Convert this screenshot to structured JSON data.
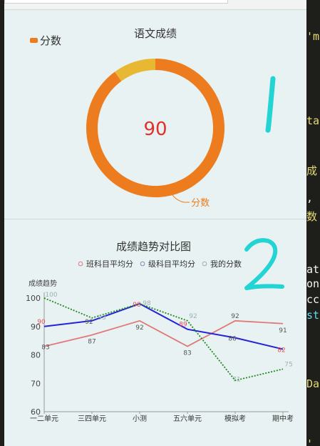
{
  "editor": {
    "fragments": [
      "'m",
      "ta",
      "成",
      ",",
      "数",
      "at",
      "on",
      "cc",
      "st",
      "Da",
      "'"
    ]
  },
  "donut": {
    "title": "语文成绩",
    "legend_label": "分数",
    "center_value": "90",
    "slice_label": "分数",
    "colors": {
      "score": "#ec7c1e",
      "remainder": "#e8b832",
      "center_text": "#e0312a"
    }
  },
  "trend": {
    "title": "成绩趋势对比图",
    "legend": [
      "班科目平均分",
      "级科目平均分",
      "我的分数"
    ],
    "ylabel": "成绩趋势"
  },
  "annotations": {
    "mark1": "1",
    "mark2": "2"
  },
  "chart_data": [
    {
      "type": "pie",
      "title": "语文成绩",
      "categories": [
        "分数",
        ""
      ],
      "values": [
        90,
        10
      ],
      "center_label": "90",
      "legend": [
        "分数"
      ],
      "legend_position": "top-left"
    },
    {
      "type": "line",
      "title": "成绩趋势对比图",
      "ylabel": "成绩趋势",
      "xlabel": "",
      "categories": [
        "一二单元",
        "三四单元",
        "小测",
        "五六单元",
        "模拟考",
        "期中考"
      ],
      "ylim": [
        60,
        100
      ],
      "yticks": [
        60,
        70,
        80,
        90,
        100
      ],
      "grid": false,
      "legend_position": "top",
      "series": [
        {
          "name": "班科目平均分",
          "values": [
            83,
            87,
            92,
            83,
            92,
            91
          ],
          "color": "#e07a78",
          "style": "solid"
        },
        {
          "name": "级科目平均分",
          "values": [
            90,
            92,
            98,
            89,
            86,
            82
          ],
          "color": "#2323d8",
          "style": "solid"
        },
        {
          "name": "我的分数",
          "values": [
            100,
            93,
            98,
            92,
            71,
            75
          ],
          "color": "#1e8a1e",
          "style": "dotted"
        }
      ]
    }
  ]
}
